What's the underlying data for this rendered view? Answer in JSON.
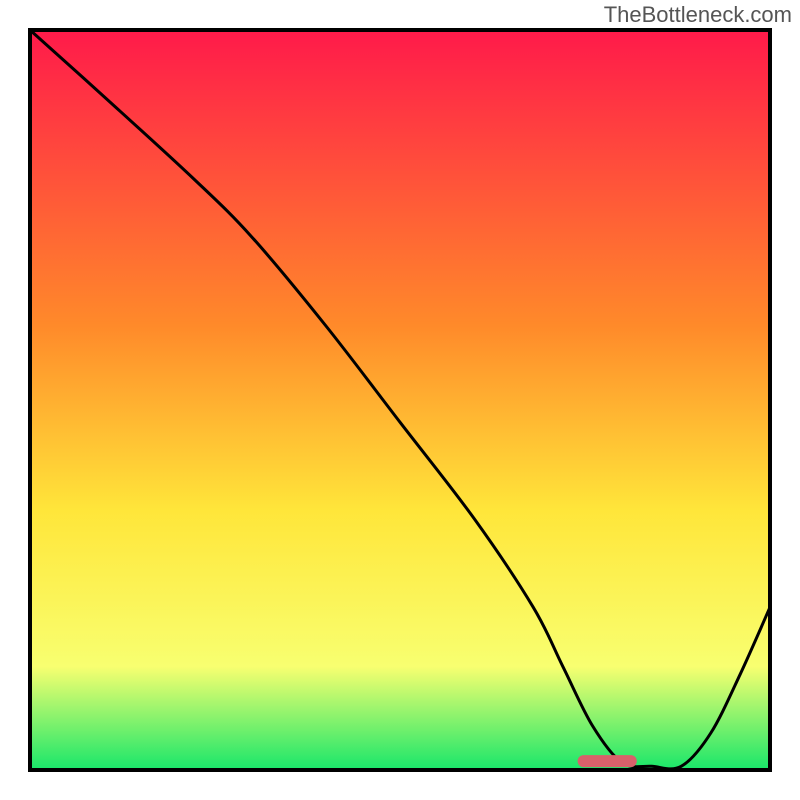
{
  "watermark": "TheBottleneck.com",
  "colors": {
    "gradient_top": "#ff1a4a",
    "gradient_mid1": "#ff8a2a",
    "gradient_mid2": "#ffe63a",
    "gradient_mid3": "#f8ff70",
    "gradient_bottom": "#18e66a",
    "border": "#000000",
    "curve": "#000000",
    "marker_fill": "#d9606a",
    "marker_stroke": "#d9606a"
  },
  "chart_data": {
    "type": "line",
    "title": "",
    "xlabel": "",
    "ylabel": "",
    "xlim": [
      0,
      100
    ],
    "ylim": [
      0,
      100
    ],
    "series": [
      {
        "name": "bottleneck-curve",
        "x": [
          0,
          10,
          22,
          30,
          40,
          50,
          60,
          68,
          72,
          76,
          80,
          84,
          88,
          92,
          96,
          100
        ],
        "y": [
          100,
          91,
          80,
          72,
          60,
          47,
          34,
          22,
          14,
          6,
          1,
          0.5,
          0.5,
          5,
          13,
          22
        ]
      }
    ],
    "marker": {
      "x_center": 78,
      "y": 1.2,
      "width": 8
    }
  }
}
